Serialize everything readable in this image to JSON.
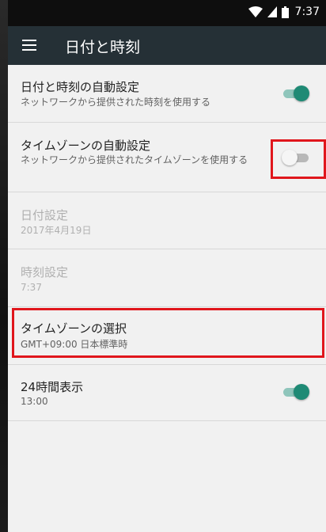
{
  "status_bar": {
    "time": "7:37"
  },
  "toolbar": {
    "title": "日付と時刻"
  },
  "settings": [
    {
      "title": "日付と時刻の自動設定",
      "summary": "ネットワークから提供された時刻を使用する",
      "switch": "on"
    },
    {
      "title": "タイムゾーンの自動設定",
      "summary": "ネットワークから提供されたタイムゾーンを使用する",
      "switch": "off"
    },
    {
      "title": "日付設定",
      "summary": "2017年4月19日",
      "disabled": true
    },
    {
      "title": "時刻設定",
      "summary": "7:37",
      "disabled": true
    },
    {
      "title": "タイムゾーンの選択",
      "summary": "GMT+09:00 日本標準時"
    },
    {
      "title": "24時間表示",
      "summary": "13:00",
      "switch": "on"
    }
  ],
  "colors": {
    "accent": "#1f8a75",
    "toolbar": "#253036",
    "highlight": "#e0161c"
  },
  "icons": [
    "menu-icon",
    "wifi-icon",
    "signal-icon",
    "battery-icon"
  ]
}
